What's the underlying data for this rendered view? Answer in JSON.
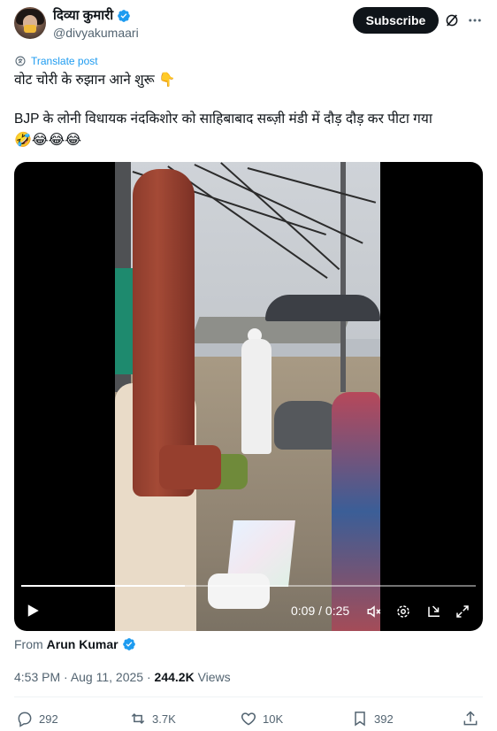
{
  "author": {
    "display_name": "दिव्या कुमारी",
    "handle": "@divyakumaari"
  },
  "header": {
    "subscribe_label": "Subscribe"
  },
  "tweet": {
    "translate_label": "Translate post",
    "line1": "वोट चोरी के रुझान आने शुरू 👇",
    "line2": "BJP के लोनी विधायक नंदकिशोर को साहिबाबाद सब्ज़ी मंडी में दौड़ दौड़ कर पीटा गया",
    "line3": "🤣😂😂😂"
  },
  "video": {
    "current_time": "0:09",
    "separator": " / ",
    "duration": "0:25",
    "progress_fraction": 0.36
  },
  "source": {
    "from_label": "From",
    "author": "Arun Kumar"
  },
  "meta": {
    "time": "4:53 PM",
    "dot": " · ",
    "date": "Aug 11, 2025",
    "views_count": "244.2K",
    "views_label": " Views"
  },
  "actions": {
    "replies": "292",
    "reposts": "3.7K",
    "likes": "10K",
    "bookmarks": "392"
  },
  "colors": {
    "accent": "#1d9bf0",
    "text": "#0f1419",
    "secondary": "#536471"
  }
}
